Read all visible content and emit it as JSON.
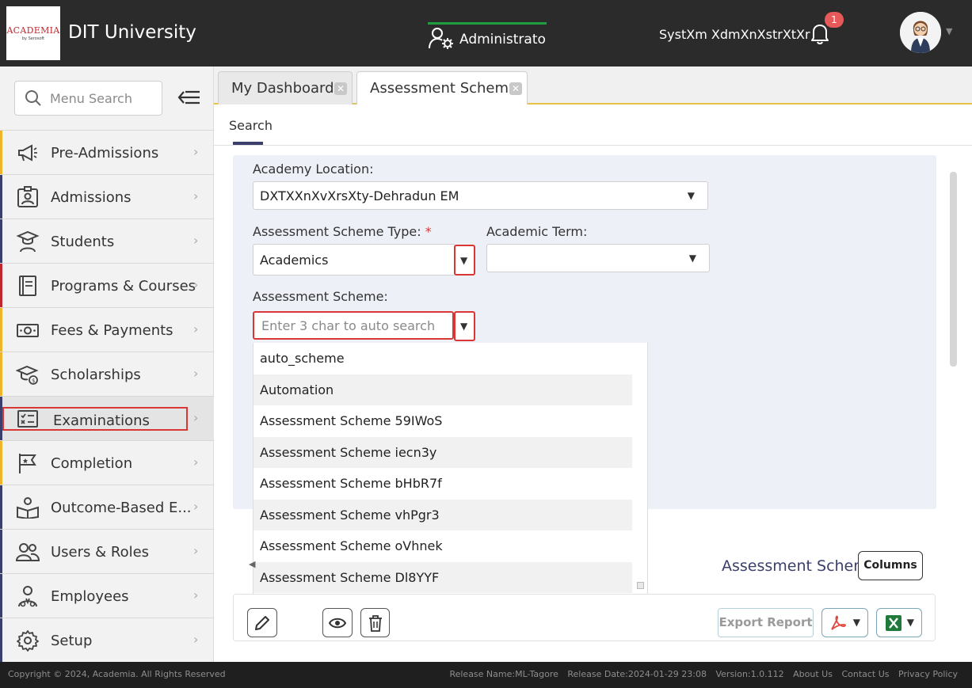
{
  "header": {
    "logo_text": "ACADEMIA",
    "logo_sub": "by Serosoft",
    "university": "DIT University",
    "role": "Administrator",
    "user_name": "SystXm XdmXnXstrXtXr",
    "notification_count": "1"
  },
  "sidebar": {
    "search_placeholder": "Menu Search",
    "items": [
      {
        "label": "Pre-Admissions",
        "icon": "megaphone-icon",
        "color": "#f0b429"
      },
      {
        "label": "Admissions",
        "icon": "id-card-icon",
        "color": "#3a3f6b"
      },
      {
        "label": "Students",
        "icon": "graduate-icon",
        "color": "#3a3f6b"
      },
      {
        "label": "Programs & Courses",
        "icon": "book-icon",
        "color": "#c0262d"
      },
      {
        "label": "Fees & Payments",
        "icon": "money-icon",
        "color": "#f0b429"
      },
      {
        "label": "Scholarships",
        "icon": "scholarship-icon",
        "color": "#f0b429"
      },
      {
        "label": "Examinations",
        "icon": "exam-checklist-icon",
        "color": "#3a3f6b"
      },
      {
        "label": "Completion",
        "icon": "flag-icon",
        "color": "#f0b429"
      },
      {
        "label": "Outcome-Based E...",
        "icon": "outcome-icon",
        "color": "#3a3f6b"
      },
      {
        "label": "Users & Roles",
        "icon": "users-icon",
        "color": "#3a3f6b"
      },
      {
        "label": "Employees",
        "icon": "employee-icon",
        "color": "#3a3f6b"
      },
      {
        "label": "Setup",
        "icon": "gear-icon",
        "color": "#3a3f6b"
      }
    ]
  },
  "tabs": {
    "tab1": "My Dashboard",
    "tab2": "Assessment Scheme"
  },
  "subnav": {
    "search": "Search"
  },
  "form": {
    "academy_location_label": "Academy Location:",
    "academy_location_value": "DXTXXnXvXrsXty-Dehradun EM",
    "scheme_type_label": "Assessment Scheme Type:",
    "scheme_type_required": "*",
    "scheme_type_value": "Academics",
    "academic_term_label": "Academic Term:",
    "academic_term_value": "",
    "scheme_label": "Assessment Scheme:",
    "scheme_placeholder": "Enter 3 char to auto search"
  },
  "dropdown_options": [
    "auto_scheme",
    "Automation",
    "Assessment Scheme 59IWoS",
    "Assessment Scheme iecn3y",
    "Assessment Scheme bHbR7f",
    "Assessment Scheme vhPgr3",
    "Assessment Scheme oVhnek",
    "Assessment Scheme Dl8YYF"
  ],
  "grid": {
    "title": "Assessment Scheme",
    "columns_button": "Columns",
    "export_button": "Export Report"
  },
  "footer": {
    "copyright": "Copyright © 2024, Academia. All Rights Reserved",
    "release_name": "Release Name:ML-Tagore",
    "release_date": "Release Date:2024-01-29 23:08",
    "version": "Version:1.0.112",
    "about": "About Us",
    "contact": "Contact Us",
    "privacy": "Privacy Policy"
  }
}
